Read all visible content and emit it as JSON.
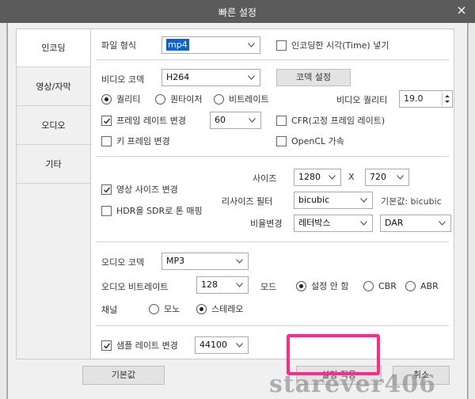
{
  "window": {
    "title": "빠른 설정",
    "close_label": "x"
  },
  "tabs": [
    {
      "label": "인코딩",
      "active": true
    },
    {
      "label": "영상/자막",
      "active": false
    },
    {
      "label": "오디오",
      "active": false
    },
    {
      "label": "기타",
      "active": false
    }
  ],
  "format": {
    "label": "파일 형식",
    "value": "mp4",
    "insert_time_label": "인코딩한 시각(Time) 넣기",
    "insert_time_checked": false
  },
  "video": {
    "codec_label": "비디오 코덱",
    "codec_value": "H264",
    "codec_settings_label": "코덱 설정",
    "mode_options": [
      {
        "label": "퀄리티",
        "selected": true
      },
      {
        "label": "퀀타이저",
        "selected": false
      },
      {
        "label": "비트레이트",
        "selected": false
      }
    ],
    "quality_label": "비디오 퀄리티",
    "quality_value": "19.0",
    "fps_change_label": "프레임 레이트 변경",
    "fps_change_checked": true,
    "fps_value": "60",
    "cfr_label": "CFR(고정 프레임 레이트)",
    "cfr_checked": false,
    "keyframe_label": "키 프레임 변경",
    "keyframe_checked": false,
    "opencl_label": "OpenCL 가속",
    "opencl_checked": false
  },
  "resize": {
    "resize_label": "영상 사이즈 변경",
    "resize_checked": true,
    "hdr_label": "HDR을 SDR로 톤 매핑",
    "hdr_checked": false,
    "size_label": "사이즈",
    "width": "1280",
    "x_label": "X",
    "height": "720",
    "filter_label": "리사이즈 필터",
    "filter_value": "bicubic",
    "filter_default_label": "기본값: bicubic",
    "ratio_label": "비율변경",
    "ratio_value": "레터박스",
    "ratio_mode": "DAR"
  },
  "audio": {
    "codec_label": "오디오 코덱",
    "codec_value": "MP3",
    "bitrate_label": "오디오 비트레이트",
    "bitrate_value": "128",
    "mode_label": "모드",
    "mode_options": [
      {
        "label": "설정 안 함",
        "selected": true
      },
      {
        "label": "CBR",
        "selected": false
      },
      {
        "label": "ABR",
        "selected": false
      }
    ],
    "channel_label": "채널",
    "channel_options": [
      {
        "label": "모노",
        "selected": false
      },
      {
        "label": "스테레오",
        "selected": true
      }
    ],
    "samplerate_label": "샘플 레이트 변경",
    "samplerate_checked": true,
    "samplerate_value": "44100"
  },
  "footer": {
    "default_label": "기본값",
    "apply_label": "설정 적용",
    "cancel_label": "취소"
  },
  "watermark": "starever406",
  "colors": {
    "highlight": "#ff2b8a",
    "selection": "#0b63d8",
    "titlebar": "#5b5b5b"
  }
}
